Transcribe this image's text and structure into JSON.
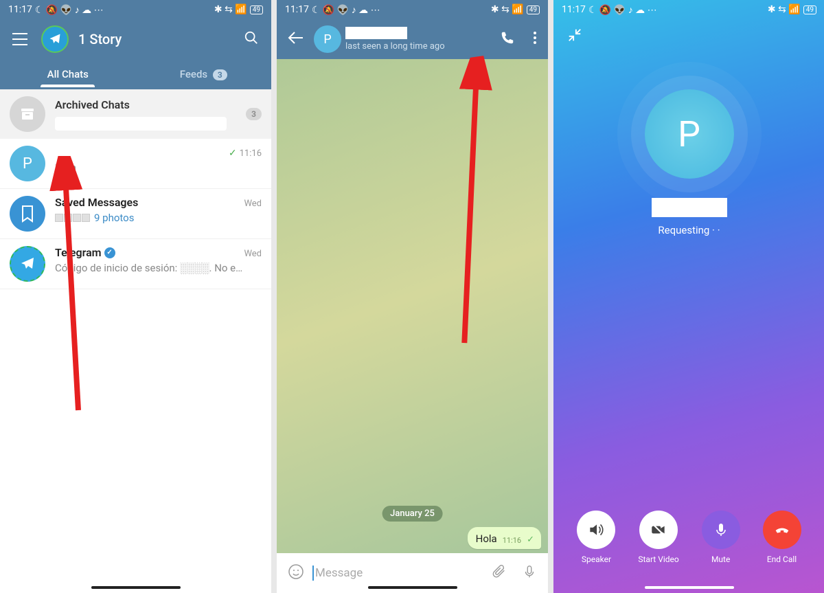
{
  "status": {
    "time": "11:17",
    "battery": "49"
  },
  "s1": {
    "title": "1 Story",
    "tabs": {
      "all": "All Chats",
      "feeds": "Feeds",
      "feeds_badge": "3"
    },
    "archived": {
      "title": "Archived Chats",
      "badge": "3"
    },
    "chats": [
      {
        "letter": "P",
        "msg": "Hola",
        "time": "11:16"
      },
      {
        "name": "Saved Messages",
        "photos": "9 photos",
        "time": "Wed"
      },
      {
        "name": "Telegram",
        "msg": "Código de inicio de sesión: ░░░░. No e…",
        "time": "Wed"
      }
    ]
  },
  "s2": {
    "last_seen": "last seen a long time ago",
    "date": "January 25",
    "bubble": {
      "text": "Hola",
      "time": "11:16"
    },
    "placeholder": "Message"
  },
  "s3": {
    "letter": "P",
    "status": "Requesting · ·",
    "controls": {
      "speaker": "Speaker",
      "video": "Start Video",
      "mute": "Mute",
      "end": "End Call"
    }
  }
}
